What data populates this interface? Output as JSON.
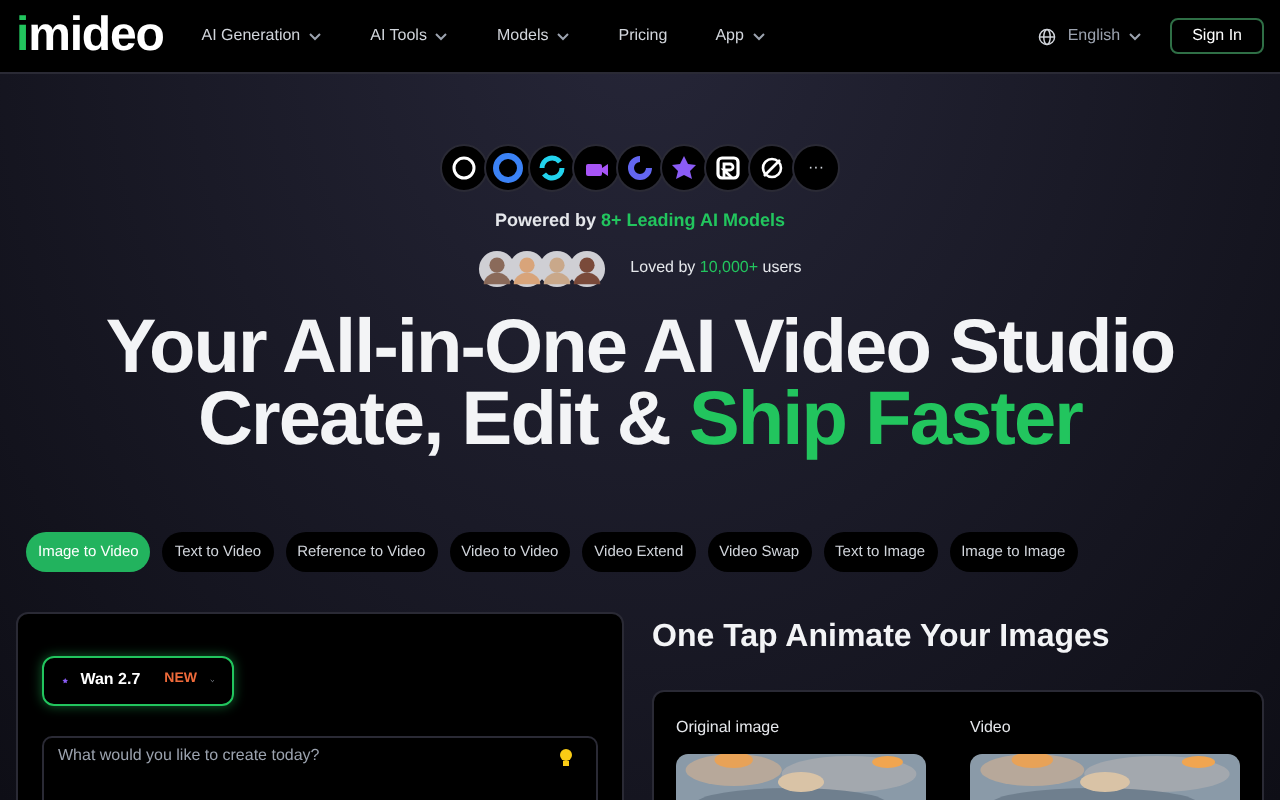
{
  "logo": {
    "accent": "i",
    "rest": "mideo"
  },
  "nav": [
    {
      "label": "AI Generation",
      "dropdown": true
    },
    {
      "label": "AI Tools",
      "dropdown": true
    },
    {
      "label": "Models",
      "dropdown": true
    },
    {
      "label": "Pricing",
      "dropdown": false
    },
    {
      "label": "App",
      "dropdown": true
    }
  ],
  "language": "English",
  "sign_in": "Sign In",
  "models_more": "···",
  "powered": {
    "text": "Powered by ",
    "highlight": "8+ Leading AI Models"
  },
  "loved": {
    "text": "Loved by ",
    "highlight": "10,000+",
    "suffix": " users"
  },
  "headline": {
    "line1": "Your All-in-One AI Video Studio",
    "line2": "Create, Edit & ",
    "line2_accent": "Ship Faster"
  },
  "tabs": [
    {
      "label": "Image to Video",
      "selected": true
    },
    {
      "label": "Text to Video",
      "selected": false
    },
    {
      "label": "Reference to Video",
      "selected": false
    },
    {
      "label": "Video to Video",
      "selected": false
    },
    {
      "label": "Video Extend",
      "selected": false
    },
    {
      "label": "Video Swap",
      "selected": false
    },
    {
      "label": "Text to Image",
      "selected": false
    },
    {
      "label": "Image to Image",
      "selected": false
    }
  ],
  "composer": {
    "model": "Wan 2.7",
    "badge": "NEW",
    "placeholder": "What would you like to create today?"
  },
  "showcase": {
    "title": "One Tap Animate Your Images",
    "columns": [
      {
        "label": "Original image",
        "kind": "picture"
      },
      {
        "label": "Video",
        "kind": "picture"
      }
    ]
  }
}
